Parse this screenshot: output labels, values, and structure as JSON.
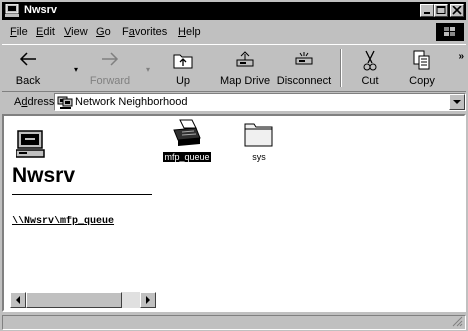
{
  "window": {
    "title": "Nwsrv"
  },
  "menu": [
    {
      "label": "File",
      "key": "F",
      "rest": "ile"
    },
    {
      "label": "Edit",
      "key": "E",
      "rest": "dit"
    },
    {
      "label": "View",
      "key": "V",
      "rest": "iew"
    },
    {
      "label": "Go",
      "key": "G",
      "rest": "o"
    },
    {
      "label": "Favorites",
      "key": "a",
      "pre": "F",
      "rest": "vorites"
    },
    {
      "label": "Help",
      "key": "H",
      "rest": "elp"
    }
  ],
  "toolbar": {
    "back": "Back",
    "forward": "Forward",
    "up": "Up",
    "map_drive": "Map Drive",
    "disconnect": "Disconnect",
    "cut": "Cut",
    "copy": "Copy",
    "more": "»"
  },
  "address": {
    "label": "Address",
    "label_key": "d",
    "value": "Network Neighborhood"
  },
  "pane": {
    "title": "Nwsrv",
    "link": "\\\\Nwsrv\\mfp_queue"
  },
  "items": [
    {
      "label": "mfp_queue",
      "icon": "printer-icon",
      "selected": true
    },
    {
      "label": "sys",
      "icon": "folder-icon",
      "selected": false
    }
  ],
  "status": {
    "text": ""
  },
  "colors": {
    "titlebar": "#000000",
    "face": "#c0c0c0",
    "content": "#ffffff"
  }
}
